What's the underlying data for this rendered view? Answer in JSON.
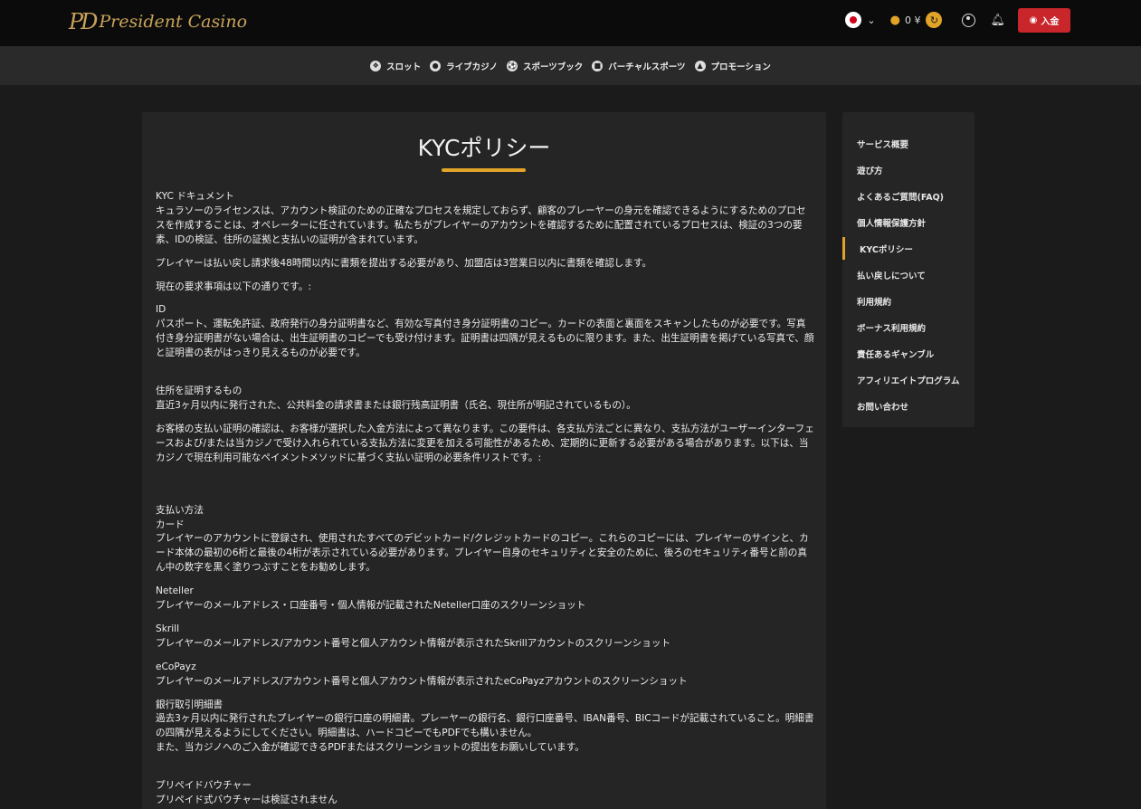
{
  "header": {
    "logo_mark": "PD",
    "logo_text": "President Casino",
    "balance": "0 ¥",
    "deposit_label": "入金"
  },
  "nav": {
    "items": [
      {
        "label": "スロット",
        "icon": "slot-icon"
      },
      {
        "label": "ライブカジノ",
        "icon": "live-casino-icon"
      },
      {
        "label": "スポーツブック",
        "icon": "sportsbook-icon"
      },
      {
        "label": "バーチャルスポーツ",
        "icon": "virtual-sports-icon"
      },
      {
        "label": "プロモーション",
        "icon": "promotion-icon"
      }
    ]
  },
  "page": {
    "title": "KYCポリシー",
    "paragraphs": [
      [
        "KYC ドキュメント",
        "キュラソーのライセンスは、アカウント検証のための正確なプロセスを規定しておらず、顧客のプレーヤーの身元を確認できるようにするためのプロセスを作成することは、オペレーターに任されています。私たちがプレイヤーのアカウントを確認するために配置されているプロセスは、検証の3つの要素、IDの検証、住所の証拠と支払いの証明が含まれています。"
      ],
      [
        "プレイヤーは払い戻し請求後48時間以内に書類を提出する必要があり、加盟店は3営業日以内に書類を確認します。"
      ],
      [
        "現在の要求事項は以下の通りです。:"
      ],
      [
        "ID",
        "パスポート、運転免許証、政府発行の身分証明書など、有効な写真付き身分証明書のコピー。カードの表面と裏面をスキャンしたものが必要です。写真付き身分証明書がない場合は、出生証明書のコピーでも受け付けます。証明書は四隅が見えるものに限ります。また、出生証明書を掲げている写真で、顔と証明書の表がはっきり見えるものが必要です。"
      ],
      [
        "住所を証明するもの",
        "直近3ヶ月以内に発行された、公共料金の請求書または銀行残高証明書（氏名、現住所が明記されているもの）。"
      ],
      [
        "お客様の支払い証明の確認は、お客様が選択した入金方法によって異なります。この要件は、各支払方法ごとに異なり、支払方法がユーザーインターフェースおよび/または当カジノで受け入れられている支払方法に変更を加える可能性があるため、定期的に更新する必要がある場合があります。以下は、当カジノで現在利用可能なペイメントメソッドに基づく支払い証明の必要条件リストです。:"
      ],
      [
        "支払い方法",
        "カード",
        "プレイヤーのアカウントに登録され、使用されたすべてのデビットカード/クレジットカードのコピー。これらのコピーには、プレイヤーのサインと、カード本体の最初の6桁と最後の4桁が表示されている必要があります。プレイヤー自身のセキュリティと安全のために、後ろのセキュリティ番号と前の真ん中の数字を黒く塗りつぶすことをお勧めします。"
      ],
      [
        "Neteller",
        "プレイヤーのメールアドレス・口座番号・個人情報が記載されたNeteller口座のスクリーンショット"
      ],
      [
        "Skrill",
        "プレイヤーのメールアドレス/アカウント番号と個人アカウント情報が表示されたSkrillアカウントのスクリーンショット"
      ],
      [
        "eCoPayz",
        "プレイヤーのメールアドレス/アカウント番号と個人アカウント情報が表示されたeCoPayzアカウントのスクリーンショット"
      ],
      [
        "銀行取引明細書",
        "過去3ヶ月以内に発行されたプレイヤーの銀行口座の明細書。プレーヤーの銀行名、銀行口座番号、IBAN番号、BICコードが記載されていること。明細書の四隅が見えるようにしてください。明細書は、ハードコピーでもPDFでも構いません。",
        "また、当カジノへのご入金が確認できるPDFまたはスクリーンショットの提出をお願いしています。"
      ],
      [
        "プリペイドバウチャー",
        "プリペイド式バウチャーは検証されません"
      ]
    ]
  },
  "sidebar": {
    "items": [
      "サービス概要",
      "遊び方",
      "よくあるご質問(FAQ)",
      "個人情報保護方針",
      "KYCポリシー",
      "払い戻しについて",
      "利用規約",
      "ボーナス利用規約",
      "責任あるギャンブル",
      "アフィリエイトプログラム",
      "お問い合わせ"
    ],
    "active_index": 4
  },
  "colors": {
    "accent": "#e2a329",
    "deposit": "#c8262b",
    "topbar": "#0b0b0b",
    "navbar": "#2a2a2a",
    "panel": "#252525"
  }
}
